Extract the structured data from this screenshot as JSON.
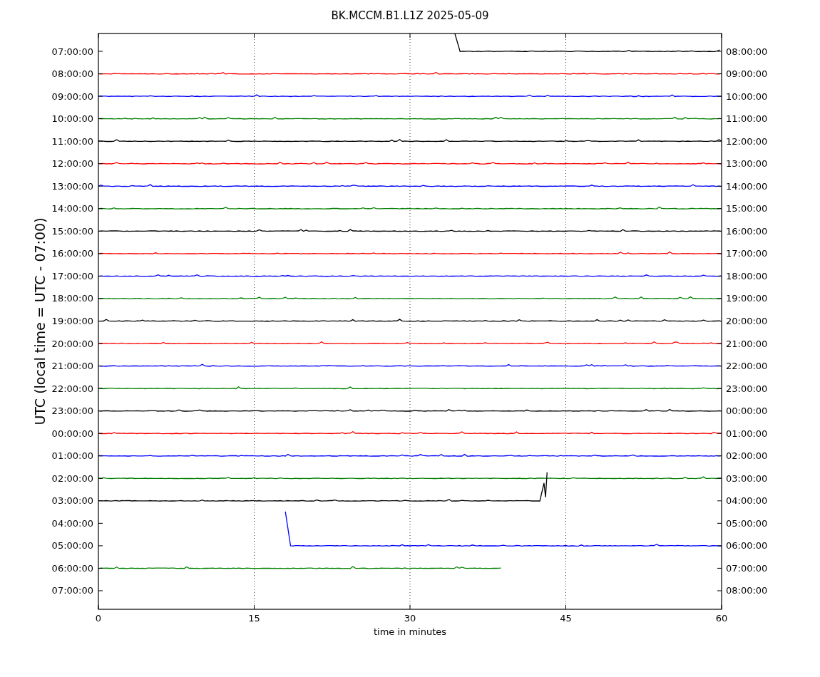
{
  "title": "BK.MCCM.B1.L1Z 2025-05-09",
  "ylabel": "UTC (local time = UTC - 07:00)",
  "xlabel": "time in minutes",
  "xticks": [
    "0",
    "15",
    "30",
    "45",
    "60"
  ],
  "rows": [
    {
      "left": "07:00:00",
      "right": "08:00:00",
      "trace": {
        "color": "#000000",
        "kind": "late-start",
        "level": 0.428
      }
    },
    {
      "left": "08:00:00",
      "right": "09:00:00",
      "trace": {
        "color": "#ff0000",
        "kind": "full"
      }
    },
    {
      "left": "09:00:00",
      "right": "10:00:00",
      "trace": {
        "color": "#0000ff",
        "kind": "full"
      }
    },
    {
      "left": "10:00:00",
      "right": "11:00:00",
      "trace": {
        "color": "#008000",
        "kind": "full"
      }
    },
    {
      "left": "11:00:00",
      "right": "12:00:00",
      "trace": {
        "color": "#000000",
        "kind": "full"
      }
    },
    {
      "left": "12:00:00",
      "right": "13:00:00",
      "trace": {
        "color": "#ff0000",
        "kind": "full"
      }
    },
    {
      "left": "13:00:00",
      "right": "14:00:00",
      "trace": {
        "color": "#0000ff",
        "kind": "full"
      }
    },
    {
      "left": "14:00:00",
      "right": "15:00:00",
      "trace": {
        "color": "#008000",
        "kind": "full"
      }
    },
    {
      "left": "15:00:00",
      "right": "16:00:00",
      "trace": {
        "color": "#000000",
        "kind": "full"
      }
    },
    {
      "left": "16:00:00",
      "right": "17:00:00",
      "trace": {
        "color": "#ff0000",
        "kind": "full"
      }
    },
    {
      "left": "17:00:00",
      "right": "18:00:00",
      "trace": {
        "color": "#0000ff",
        "kind": "full"
      }
    },
    {
      "left": "18:00:00",
      "right": "19:00:00",
      "trace": {
        "color": "#008000",
        "kind": "full"
      }
    },
    {
      "left": "19:00:00",
      "right": "20:00:00",
      "trace": {
        "color": "#000000",
        "kind": "full"
      }
    },
    {
      "left": "20:00:00",
      "right": "21:00:00",
      "trace": {
        "color": "#ff0000",
        "kind": "full"
      }
    },
    {
      "left": "21:00:00",
      "right": "22:00:00",
      "trace": {
        "color": "#0000ff",
        "kind": "full"
      }
    },
    {
      "left": "22:00:00",
      "right": "23:00:00",
      "trace": {
        "color": "#008000",
        "kind": "full"
      }
    },
    {
      "left": "23:00:00",
      "right": "00:00:00",
      "trace": {
        "color": "#000000",
        "kind": "full"
      }
    },
    {
      "left": "00:00:00",
      "right": "01:00:00",
      "trace": {
        "color": "#ff0000",
        "kind": "full"
      }
    },
    {
      "left": "01:00:00",
      "right": "02:00:00",
      "trace": {
        "color": "#0000ff",
        "kind": "full"
      }
    },
    {
      "left": "02:00:00",
      "right": "03:00:00",
      "trace": {
        "color": "#008000",
        "kind": "full"
      }
    },
    {
      "left": "03:00:00",
      "right": "04:00:00",
      "trace": {
        "color": "#000000",
        "kind": "spike-end",
        "level": 0.72
      }
    },
    {
      "left": "04:00:00",
      "right": "05:00:00"
    },
    {
      "left": "05:00:00",
      "right": "06:00:00",
      "trace": {
        "color": "#0000ff",
        "kind": "late-start",
        "level": 0.7
      }
    },
    {
      "left": "06:00:00",
      "right": "07:00:00",
      "trace": {
        "color": "#008000",
        "kind": "early-end",
        "level": 0.647
      }
    },
    {
      "left": "07:00:00",
      "right": "08:00:00"
    }
  ]
}
